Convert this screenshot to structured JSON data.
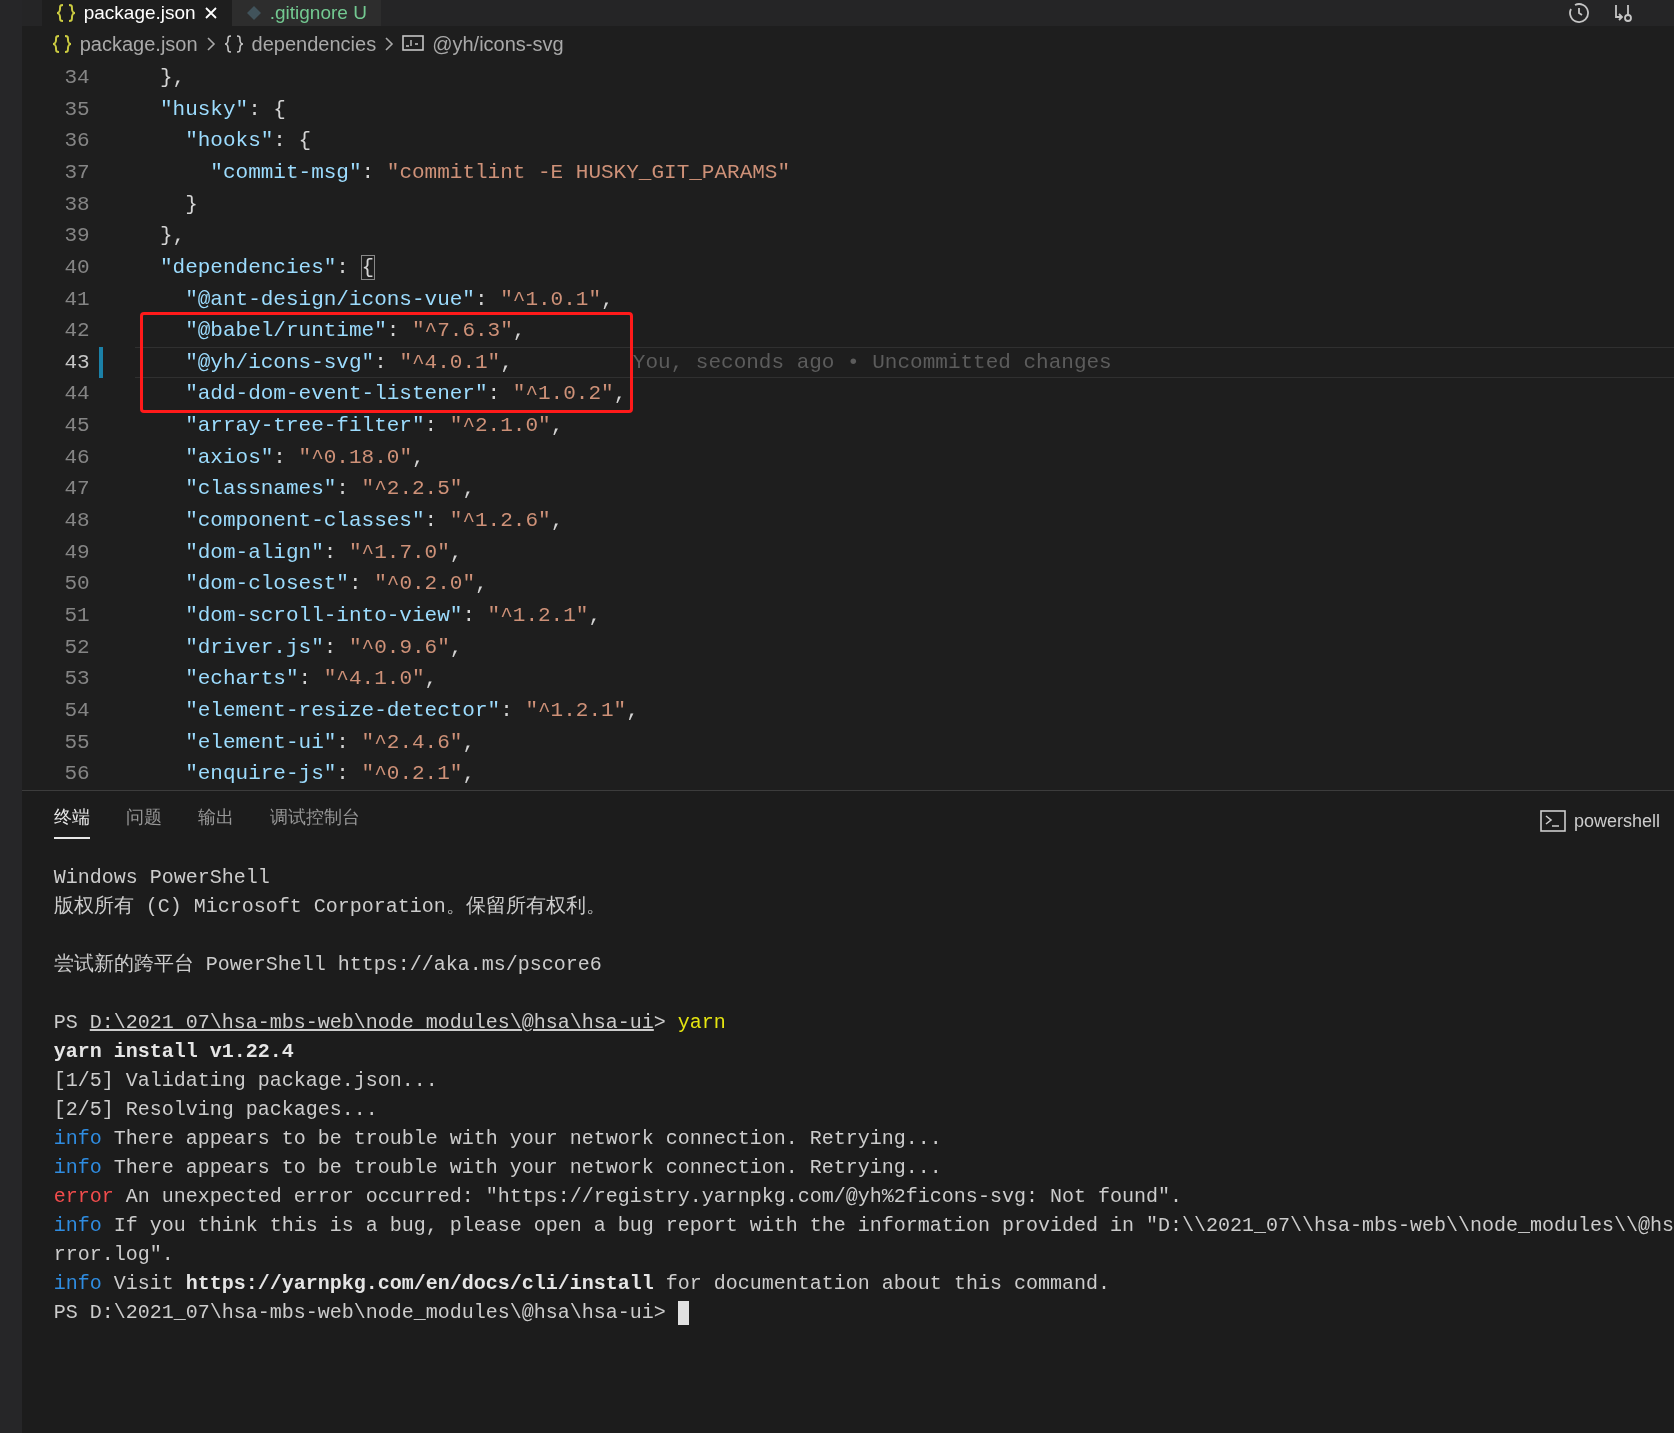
{
  "tabs": [
    {
      "label": "package.json",
      "kind": "json",
      "selected": true
    },
    {
      "label": ".gitignore",
      "kind": "git",
      "selected": false,
      "badge": "U"
    }
  ],
  "breadcrumb": [
    {
      "label": "package.json",
      "kind": "json"
    },
    {
      "label": "dependencies",
      "kind": "object"
    },
    {
      "label": "@yh/icons-svg",
      "kind": "string"
    }
  ],
  "editor": {
    "lines": [
      {
        "number": "34",
        "tokens": [
          {
            "kind": "punct",
            "text": "  },"
          }
        ]
      },
      {
        "number": "35",
        "tokens": [
          {
            "kind": "key",
            "text": "  \"husky\""
          },
          {
            "kind": "punct",
            "text": ": {"
          }
        ]
      },
      {
        "number": "36",
        "tokens": [
          {
            "kind": "key",
            "text": "    \"hooks\""
          },
          {
            "kind": "punct",
            "text": ": {"
          }
        ]
      },
      {
        "number": "37",
        "tokens": [
          {
            "kind": "key",
            "text": "      \"commit-msg\""
          },
          {
            "kind": "punct",
            "text": ": "
          },
          {
            "kind": "string",
            "text": "\"commitlint -E HUSKY_GIT_PARAMS\""
          }
        ]
      },
      {
        "number": "38",
        "tokens": [
          {
            "kind": "punct",
            "text": "    }"
          }
        ]
      },
      {
        "number": "39",
        "tokens": [
          {
            "kind": "punct",
            "text": "  },"
          }
        ]
      },
      {
        "number": "40",
        "tokens": [
          {
            "kind": "key",
            "text": "  \"dependencies\""
          },
          {
            "kind": "punct",
            "text": ": "
          },
          {
            "kind": "match",
            "text": "{"
          }
        ]
      },
      {
        "number": "41",
        "tokens": [
          {
            "kind": "key",
            "text": "    \"@ant-design/icons-vue\""
          },
          {
            "kind": "punct",
            "text": ": "
          },
          {
            "kind": "string",
            "text": "\"^1.0.1\""
          },
          {
            "kind": "punct",
            "text": ","
          }
        ]
      },
      {
        "number": "42",
        "boxed": true,
        "tokens": [
          {
            "kind": "key",
            "text": "    \"@babel/runtime\""
          },
          {
            "kind": "punct",
            "text": ": "
          },
          {
            "kind": "string",
            "text": "\"^7.6.3\""
          },
          {
            "kind": "punct",
            "text": ","
          }
        ]
      },
      {
        "number": "43",
        "boxed": true,
        "current": true,
        "modified": true,
        "blame": "You, seconds ago • Uncommitted changes",
        "tokens": [
          {
            "kind": "key",
            "text": "    \"@yh/icons-svg\""
          },
          {
            "kind": "punct",
            "text": ": "
          },
          {
            "kind": "string",
            "text": "\"^4.0.1\""
          },
          {
            "kind": "punct",
            "text": ","
          }
        ]
      },
      {
        "number": "44",
        "boxed": true,
        "tokens": [
          {
            "kind": "key",
            "text": "    \"add-dom-event-listener\""
          },
          {
            "kind": "punct",
            "text": ": "
          },
          {
            "kind": "string",
            "text": "\"^1.0.2\""
          },
          {
            "kind": "punct",
            "text": ","
          }
        ]
      },
      {
        "number": "45",
        "tokens": [
          {
            "kind": "key",
            "text": "    \"array-tree-filter\""
          },
          {
            "kind": "punct",
            "text": ": "
          },
          {
            "kind": "string",
            "text": "\"^2.1.0\""
          },
          {
            "kind": "punct",
            "text": ","
          }
        ]
      },
      {
        "number": "46",
        "tokens": [
          {
            "kind": "key",
            "text": "    \"axios\""
          },
          {
            "kind": "punct",
            "text": ": "
          },
          {
            "kind": "string",
            "text": "\"^0.18.0\""
          },
          {
            "kind": "punct",
            "text": ","
          }
        ]
      },
      {
        "number": "47",
        "tokens": [
          {
            "kind": "key",
            "text": "    \"classnames\""
          },
          {
            "kind": "punct",
            "text": ": "
          },
          {
            "kind": "string",
            "text": "\"^2.2.5\""
          },
          {
            "kind": "punct",
            "text": ","
          }
        ]
      },
      {
        "number": "48",
        "tokens": [
          {
            "kind": "key",
            "text": "    \"component-classes\""
          },
          {
            "kind": "punct",
            "text": ": "
          },
          {
            "kind": "string",
            "text": "\"^1.2.6\""
          },
          {
            "kind": "punct",
            "text": ","
          }
        ]
      },
      {
        "number": "49",
        "tokens": [
          {
            "kind": "key",
            "text": "    \"dom-align\""
          },
          {
            "kind": "punct",
            "text": ": "
          },
          {
            "kind": "string",
            "text": "\"^1.7.0\""
          },
          {
            "kind": "punct",
            "text": ","
          }
        ]
      },
      {
        "number": "50",
        "tokens": [
          {
            "kind": "key",
            "text": "    \"dom-closest\""
          },
          {
            "kind": "punct",
            "text": ": "
          },
          {
            "kind": "string",
            "text": "\"^0.2.0\""
          },
          {
            "kind": "punct",
            "text": ","
          }
        ]
      },
      {
        "number": "51",
        "tokens": [
          {
            "kind": "key",
            "text": "    \"dom-scroll-into-view\""
          },
          {
            "kind": "punct",
            "text": ": "
          },
          {
            "kind": "string",
            "text": "\"^1.2.1\""
          },
          {
            "kind": "punct",
            "text": ","
          }
        ]
      },
      {
        "number": "52",
        "tokens": [
          {
            "kind": "key",
            "text": "    \"driver.js\""
          },
          {
            "kind": "punct",
            "text": ": "
          },
          {
            "kind": "string",
            "text": "\"^0.9.6\""
          },
          {
            "kind": "punct",
            "text": ","
          }
        ]
      },
      {
        "number": "53",
        "tokens": [
          {
            "kind": "key",
            "text": "    \"echarts\""
          },
          {
            "kind": "punct",
            "text": ": "
          },
          {
            "kind": "string",
            "text": "\"^4.1.0\""
          },
          {
            "kind": "punct",
            "text": ","
          }
        ]
      },
      {
        "number": "54",
        "tokens": [
          {
            "kind": "key",
            "text": "    \"element-resize-detector\""
          },
          {
            "kind": "punct",
            "text": ": "
          },
          {
            "kind": "string",
            "text": "\"^1.2.1\""
          },
          {
            "kind": "punct",
            "text": ","
          }
        ]
      },
      {
        "number": "55",
        "tokens": [
          {
            "kind": "key",
            "text": "    \"element-ui\""
          },
          {
            "kind": "punct",
            "text": ": "
          },
          {
            "kind": "string",
            "text": "\"^2.4.6\""
          },
          {
            "kind": "punct",
            "text": ","
          }
        ]
      },
      {
        "number": "56",
        "tokens": [
          {
            "kind": "key",
            "text": "    \"enquire-js\""
          },
          {
            "kind": "punct",
            "text": ": "
          },
          {
            "kind": "string",
            "text": "\"^0.2.1\""
          },
          {
            "kind": "punct",
            "text": ","
          }
        ]
      }
    ]
  },
  "panel": {
    "tabs": [
      {
        "label": "终端",
        "selected": true
      },
      {
        "label": "问题",
        "selected": false
      },
      {
        "label": "输出",
        "selected": false
      },
      {
        "label": "调试控制台",
        "selected": false
      }
    ],
    "shell": "powershell",
    "lines": [
      {
        "segments": [
          {
            "kind": "plain",
            "text": "Windows PowerShell"
          }
        ]
      },
      {
        "segments": [
          {
            "kind": "plain",
            "text": "版权所有 (C) Microsoft Corporation。保留所有权利。"
          }
        ]
      },
      {
        "blank_before": true,
        "segments": [
          {
            "kind": "plain",
            "text": "尝试新的跨平台 PowerShell https://aka.ms/pscore6"
          }
        ]
      },
      {
        "blank_before": true,
        "segments": [
          {
            "kind": "plain",
            "text": "PS "
          },
          {
            "kind": "path",
            "text": "D:\\2021_07\\hsa-mbs-web\\node_modules\\@hsa\\hsa-ui"
          },
          {
            "kind": "plain",
            "text": "> "
          },
          {
            "kind": "command",
            "text": "yarn"
          }
        ]
      },
      {
        "segments": [
          {
            "kind": "bold",
            "text": "yarn install v1.22.4"
          }
        ]
      },
      {
        "segments": [
          {
            "kind": "plain",
            "text": "[1/5] Validating package.json..."
          }
        ]
      },
      {
        "segments": [
          {
            "kind": "plain",
            "text": "[2/5] Resolving packages..."
          }
        ]
      },
      {
        "segments": [
          {
            "kind": "info",
            "text": "info"
          },
          {
            "kind": "plain",
            "text": " There appears to be trouble with your network connection. Retrying..."
          }
        ]
      },
      {
        "segments": [
          {
            "kind": "info",
            "text": "info"
          },
          {
            "kind": "plain",
            "text": " There appears to be trouble with your network connection. Retrying..."
          }
        ]
      },
      {
        "segments": [
          {
            "kind": "error",
            "text": "error"
          },
          {
            "kind": "plain",
            "text": " An unexpected error occurred: \"https://registry.yarnpkg.com/@yh%2ficons-svg: Not found\"."
          }
        ]
      },
      {
        "segments": [
          {
            "kind": "info",
            "text": "info"
          },
          {
            "kind": "plain",
            "text": " If you think this is a bug, please open a bug report with the information provided in \"D:\\\\2021_07\\\\hsa-mbs-web\\\\node_modules\\\\@hs"
          }
        ]
      },
      {
        "segments": [
          {
            "kind": "plain",
            "text": "rror.log\"."
          }
        ]
      },
      {
        "segments": [
          {
            "kind": "info",
            "text": "info"
          },
          {
            "kind": "plain",
            "text": " Visit "
          },
          {
            "kind": "bold",
            "text": "https://yarnpkg.com/en/docs/cli/install"
          },
          {
            "kind": "plain",
            "text": " for documentation about this command."
          }
        ]
      },
      {
        "cursor": true,
        "segments": [
          {
            "kind": "plain",
            "text": "PS D:\\2021_07\\hsa-mbs-web\\node_modules\\@hsa\\hsa-ui> "
          }
        ]
      }
    ]
  }
}
